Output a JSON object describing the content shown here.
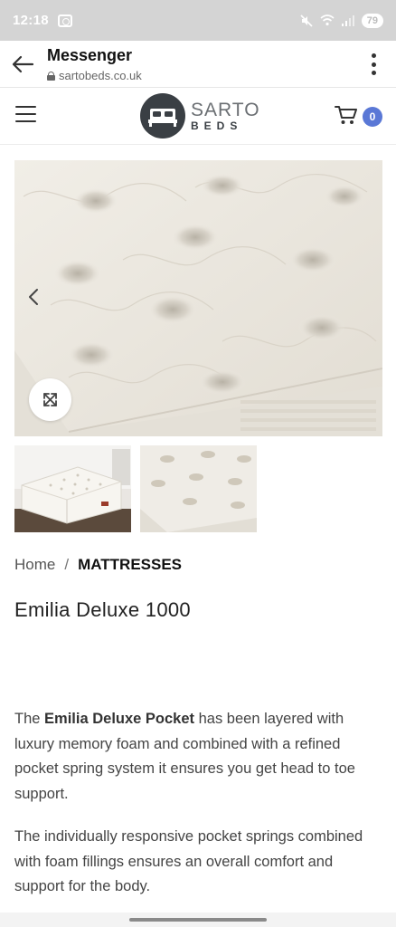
{
  "status_bar": {
    "time": "12:18",
    "battery": "79",
    "mute_icon": "mute-icon",
    "wifi_icon": "wifi-icon",
    "signal_icon": "signal-icon"
  },
  "app_bar": {
    "title": "Messenger",
    "url": "sartobeds.co.uk",
    "back_icon": "arrow-left-icon",
    "more_icon": "more-vertical-icon"
  },
  "site_header": {
    "menu_icon": "hamburger-menu-icon",
    "logo_top": "SARTO",
    "logo_bottom": "BEDS",
    "cart_icon": "cart-icon",
    "cart_count": "0",
    "accent_color": "#5a78d6"
  },
  "gallery": {
    "prev_icon": "chevron-left-icon",
    "zoom_icon": "expand-icon",
    "thumbnail_count": 2
  },
  "breadcrumb": {
    "home": "Home",
    "separator": "/",
    "current": "MATTRESSES"
  },
  "product": {
    "title": "Emilia Deluxe 1000",
    "desc1_lead": "The ",
    "desc1_bold": "Emilia Deluxe Pocket",
    "desc1_rest": " has been layered with luxury memory foam and combined with a refined pocket spring system it ensures you get head to toe support.",
    "desc2": "The individually responsive pocket springs combined with foam fillings ensures an overall comfort and support for the body."
  }
}
